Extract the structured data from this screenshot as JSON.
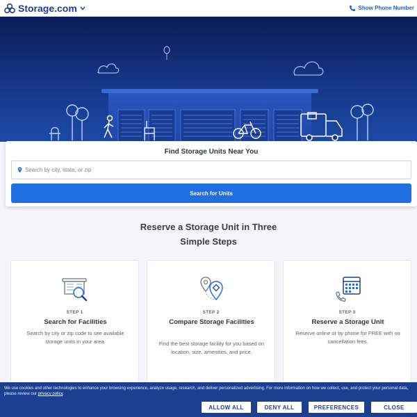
{
  "header": {
    "brand": "Storage.com",
    "phone_label": "Show Phone Number"
  },
  "search": {
    "title": "Find Storage Units Near You",
    "placeholder": "Search by city, state, or zip",
    "button_label": "Search for Units"
  },
  "steps_section": {
    "title_line1": "Reserve a Storage Unit in Three",
    "title_line2": "Simple Steps",
    "steps": [
      {
        "label": "STEP 1",
        "heading": "Search for Facilities",
        "description": "Search by city or zip code to see available storage units in your area.",
        "icon": "storage-search-icon"
      },
      {
        "label": "STEP 2",
        "heading": "Compare Storage Facilities",
        "description": "Find the best storage facility for you based on location, size, amenities, and price.",
        "icon": "map-pins-icon"
      },
      {
        "label": "STEP 3",
        "heading": "Reserve a Storage Unit",
        "description": "Reserve online or by phone for FREE with no cancellation fees.",
        "icon": "calendar-phone-icon"
      }
    ]
  },
  "cookie": {
    "text": "We use cookies and other technologies to enhance your browsing experience, analyze usage, research, and deliver personalized advertising. For more information on how we collect, use, and protect your personal data, please review our",
    "link": "privacy policy",
    "trailing": ".",
    "buttons": {
      "allow": "ALLOW ALL",
      "deny": "DENY ALL",
      "preferences": "PREFERENCES",
      "close": "CLOSE"
    }
  },
  "colors": {
    "brand": "#1f3f8c",
    "accent": "#1f6fe0",
    "hero_dark": "#0a1d57",
    "cookie_bg": "#1d3f8f"
  }
}
